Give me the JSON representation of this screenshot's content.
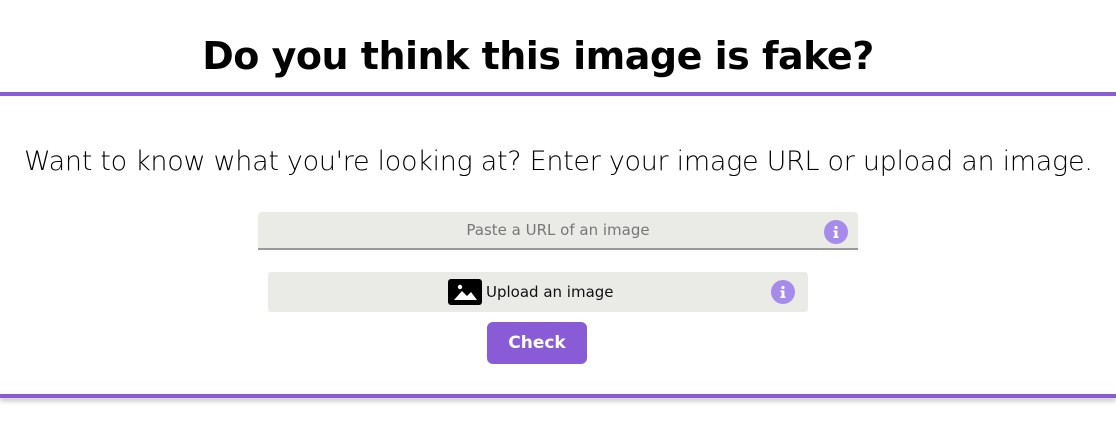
{
  "header": {
    "title": "Do you think this image is fake?"
  },
  "intro": {
    "text": "Want to know what you're looking at? Enter your image URL or upload an image."
  },
  "url_input": {
    "value": "",
    "placeholder": "Paste a URL of an image",
    "info_icon": "info-icon"
  },
  "upload": {
    "label": "Upload an image",
    "icon": "image-icon",
    "info_icon": "info-icon"
  },
  "check_button": {
    "label": "Check"
  },
  "colors": {
    "accent": "#8a5bd6",
    "info_icon": "#a78bea",
    "field_bg": "#eaeae6"
  }
}
